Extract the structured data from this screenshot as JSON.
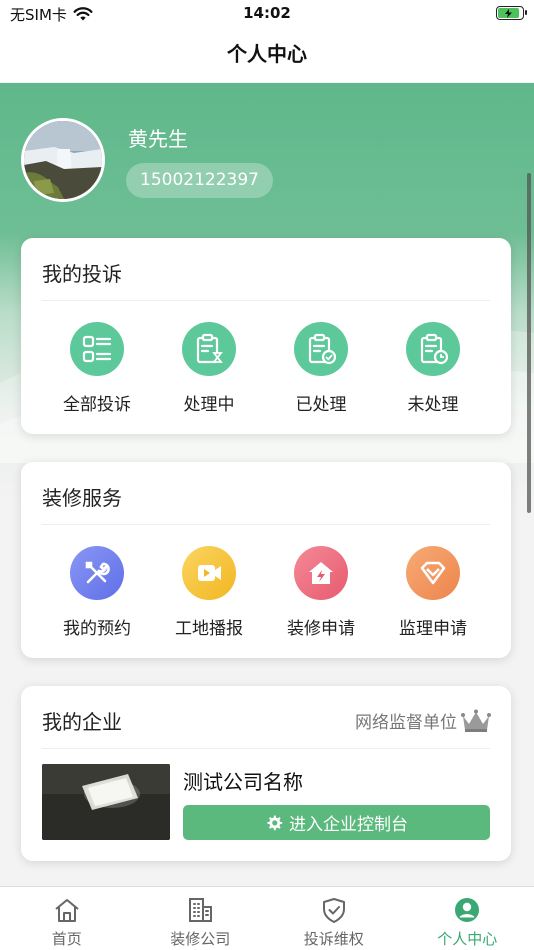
{
  "status_bar": {
    "carrier": "无SIM卡",
    "time": "14:02"
  },
  "nav": {
    "title": "个人中心"
  },
  "profile": {
    "name": "黄先生",
    "phone": "15002122397"
  },
  "complaints": {
    "title": "我的投诉",
    "items": [
      {
        "label": "全部投诉",
        "icon": "list-icon"
      },
      {
        "label": "处理中",
        "icon": "clipboard-hourglass-icon"
      },
      {
        "label": "已处理",
        "icon": "clipboard-check-icon"
      },
      {
        "label": "未处理",
        "icon": "clipboard-clock-icon"
      }
    ]
  },
  "services": {
    "title": "装修服务",
    "items": [
      {
        "label": "我的预约",
        "icon": "tools-icon",
        "color": "#6f7ff0"
      },
      {
        "label": "工地播报",
        "icon": "video-icon",
        "color": "#f7c541"
      },
      {
        "label": "装修申请",
        "icon": "house-bolt-icon",
        "color": "#ee6a7c"
      },
      {
        "label": "监理申请",
        "icon": "diamond-icon",
        "color": "#f4935a"
      }
    ]
  },
  "enterprise": {
    "title": "我的企业",
    "badge": "网络监督单位",
    "company_name": "测试公司名称",
    "console_button": "进入企业控制台"
  },
  "tabs": [
    {
      "label": "首页",
      "icon": "home-icon",
      "active": false
    },
    {
      "label": "装修公司",
      "icon": "building-icon",
      "active": false
    },
    {
      "label": "投诉维权",
      "icon": "shield-check-icon",
      "active": false
    },
    {
      "label": "个人中心",
      "icon": "user-icon",
      "active": true
    }
  ],
  "colors": {
    "brand_green": "#5cb97e",
    "active_tab": "#3aa873"
  }
}
